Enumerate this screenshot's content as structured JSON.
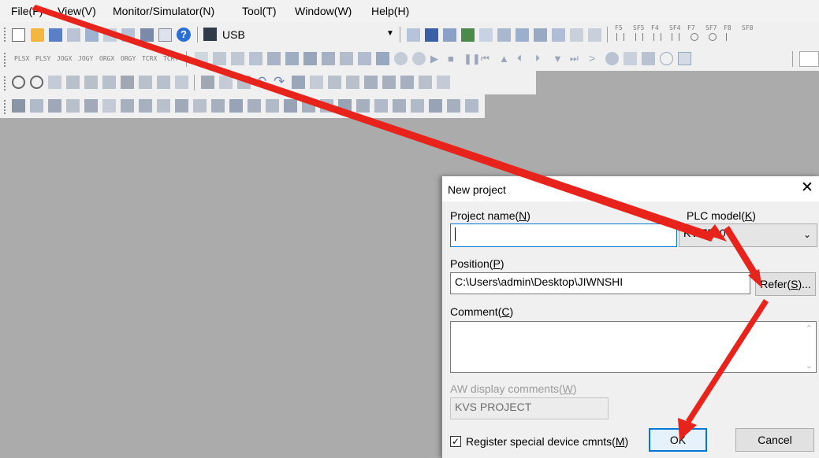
{
  "menubar": {
    "items": [
      {
        "label": "File(F)",
        "key": "F"
      },
      {
        "label": "View(V)",
        "key": "V"
      },
      {
        "label": "Monitor/Simulator(N)",
        "key": "N"
      },
      {
        "label": "Tool(T)",
        "key": "T"
      },
      {
        "label": "Window(W)",
        "key": "W"
      },
      {
        "label": "Help(H)",
        "key": "H"
      }
    ]
  },
  "toolbar": {
    "connection": "USB",
    "fn_keys": [
      "F5",
      "SF5",
      "F4",
      "SF4",
      "F7",
      "SF7",
      "F8",
      "SF8"
    ],
    "row2_labels": [
      "PLSX",
      "PLSY",
      "JOGX",
      "JOGY",
      "ORGX",
      "ORGY",
      "TCRX",
      "TCRY"
    ]
  },
  "dialog": {
    "title": "New project",
    "project_name_label": "Project name(N)",
    "project_name_key": "N",
    "project_name_value": "",
    "plc_model_label": "PLC model(K)",
    "plc_model_key": "K",
    "plc_model_value": "KV-7500",
    "position_label": "Position(P)",
    "position_key": "P",
    "position_value": "C:\\Users\\admin\\Desktop\\JIWNSHI",
    "refer_label": "Refer(S)...",
    "refer_key": "S",
    "comment_label": "Comment(C)",
    "comment_key": "C",
    "comment_value": "",
    "aw_label": "AW display comments(W)",
    "aw_key": "W",
    "aw_value": "KVS PROJECT",
    "register_label": "Register special device cmnts(M)",
    "register_key": "M",
    "register_checked": true,
    "ok_label": "OK",
    "cancel_label": "Cancel"
  },
  "annotation": {
    "arrow_color": "#e8231c"
  }
}
